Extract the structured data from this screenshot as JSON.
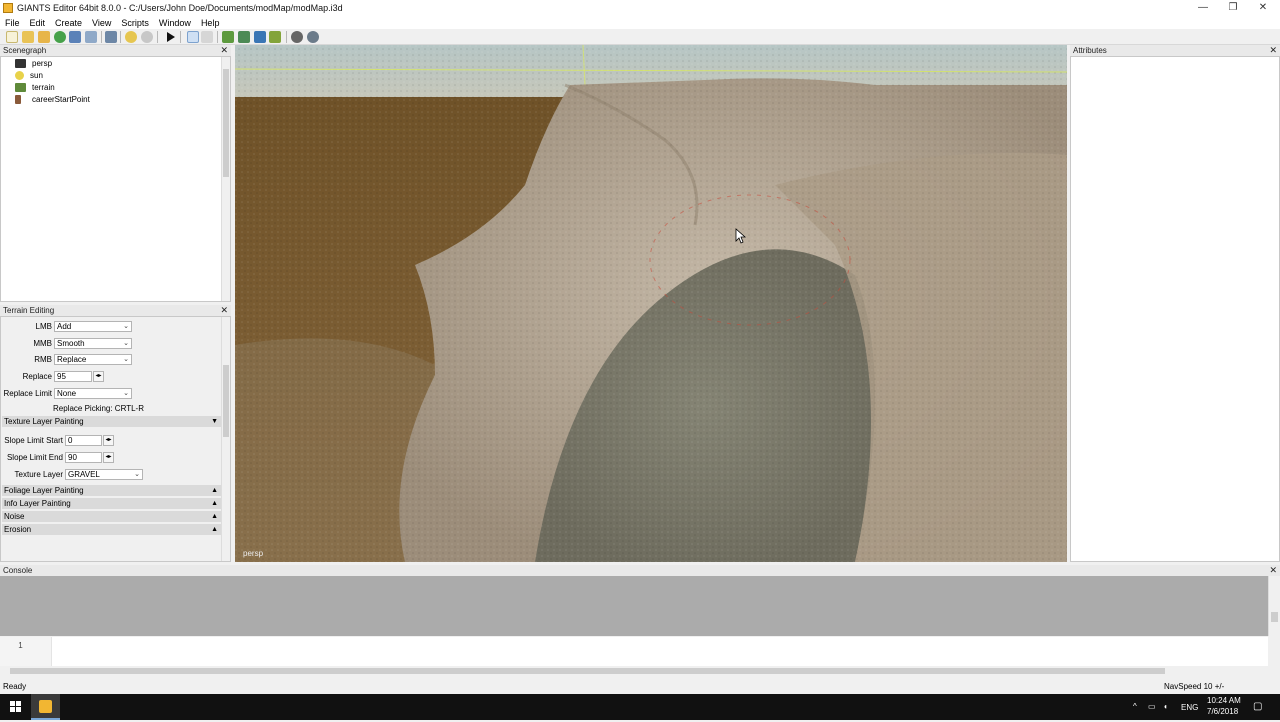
{
  "window": {
    "title": "GIANTS Editor 64bit 8.0.0 - C:/Users/John Doe/Documents/modMap/modMap.i3d",
    "minimize": "—",
    "maximize": "❐",
    "close": "✕"
  },
  "menu": [
    "File",
    "Edit",
    "Create",
    "View",
    "Scripts",
    "Window",
    "Help"
  ],
  "toolbar_icons": [
    "new-icon",
    "open-icon",
    "save-icon",
    "reload-icon",
    "export-icon",
    "import-icon",
    "copy-icon",
    "undo-icon",
    "redo-icon",
    "play-icon",
    "select-icon",
    "move-icon",
    "lock-icon",
    "terrain-sculpt-icon",
    "terrain-paint-icon",
    "foliage-paint-icon",
    "tree-paint-icon",
    "settings-icon",
    "settings-alt-icon"
  ],
  "scenegraph": {
    "title": "Scenegraph",
    "close": "✕",
    "items": [
      {
        "label": "persp",
        "icon": "camera-icon",
        "color": "#333333"
      },
      {
        "label": "sun",
        "icon": "light-bulb-icon",
        "color": "#e8d24a"
      },
      {
        "label": "terrain",
        "icon": "terrain-icon",
        "color": "#5f8a3a"
      },
      {
        "label": "careerStartPoint",
        "icon": "transform-group-icon",
        "color": "#8a5a3a"
      }
    ]
  },
  "terrain_editing": {
    "title": "Terrain Editing",
    "close": "✕",
    "lmb_label": "LMB",
    "lmb_value": "Add",
    "mmb_label": "MMB",
    "mmb_value": "Smooth",
    "rmb_label": "RMB",
    "rmb_value": "Replace",
    "replace_label": "Replace",
    "replace_value": "95",
    "replace_limit_label": "Replace Limit",
    "replace_limit_value": "None",
    "replace_picking": "Replace Picking: CRTL-R",
    "texture_section": "Texture Layer Painting",
    "slope_start_label": "Slope Limit Start",
    "slope_start_value": "0",
    "slope_end_label": "Slope Limit End",
    "slope_end_value": "90",
    "texture_layer_label": "Texture Layer",
    "texture_layer_value": "GRAVEL",
    "sections": [
      "Foliage Layer Painting",
      "Info Layer Painting",
      "Noise",
      "Erosion"
    ]
  },
  "viewport": {
    "camera_label": "persp"
  },
  "attributes": {
    "title": "Attributes",
    "close": "✕"
  },
  "console": {
    "title": "Console",
    "close": "✕",
    "line_number": "1"
  },
  "status": {
    "left": "Ready",
    "right": "NavSpeed 10 +/-"
  },
  "taskbar": {
    "time": "10:24 AM",
    "date": "7/6/2018",
    "lang": "ENG"
  },
  "colors": {
    "sky_top": "#b9c9c9",
    "ground": "#7c5a30",
    "rock": "#b7aa98",
    "gravel": "#7d7a6c",
    "grid_line": "#d8e85a",
    "brush": "#c84a3a"
  }
}
